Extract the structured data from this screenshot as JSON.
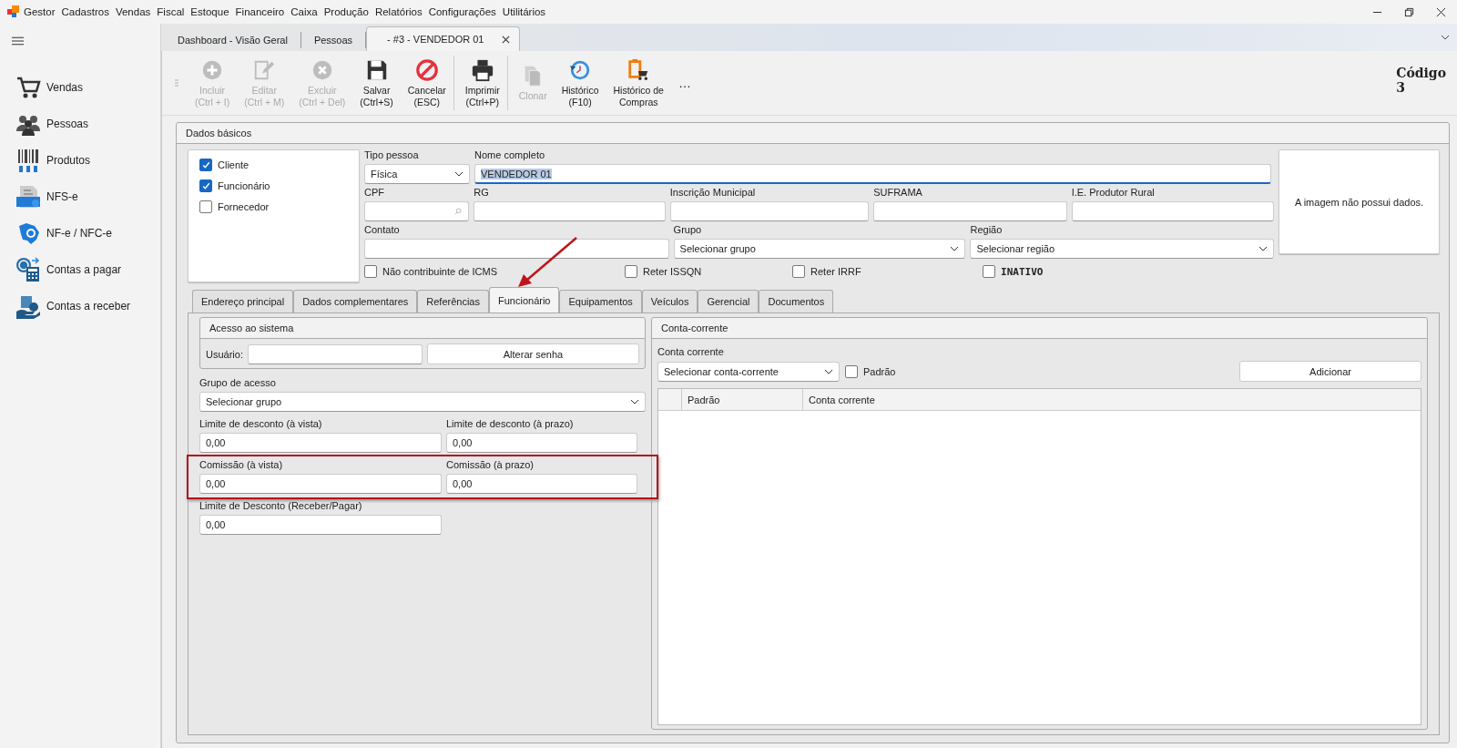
{
  "menu": {
    "app": "Gestor",
    "items": [
      "Cadastros",
      "Vendas",
      "Fiscal",
      "Estoque",
      "Financeiro",
      "Caixa",
      "Produção",
      "Relatórios",
      "Configurações",
      "Utilitários"
    ]
  },
  "sidebar": {
    "items": [
      {
        "label": "Vendas",
        "kind": "cart"
      },
      {
        "label": "Pessoas",
        "kind": "people"
      },
      {
        "label": "Produtos",
        "kind": "barcode"
      },
      {
        "label": "NFS-e",
        "kind": "nfse"
      },
      {
        "label": "NF-e / NFC-e",
        "kind": "nfe"
      },
      {
        "label": "Contas a pagar",
        "kind": "pay"
      },
      {
        "label": "Contas a receber",
        "kind": "receive"
      }
    ]
  },
  "doc_tabs": [
    {
      "label": "Dashboard - Visão Geral",
      "selected": false,
      "closable": false
    },
    {
      "label": "Pessoas",
      "selected": false,
      "closable": false
    },
    {
      "label": "- #3 - VENDEDOR 01",
      "selected": true,
      "closable": true
    }
  ],
  "toolbar": {
    "buttons": [
      {
        "label": "Incluir",
        "shortcut": "(Ctrl + I)",
        "kind": "add",
        "disabled": true,
        "separator_after": false
      },
      {
        "label": "Editar",
        "shortcut": "(Ctrl + M)",
        "kind": "edit",
        "disabled": true,
        "separator_after": false
      },
      {
        "label": "Excluir",
        "shortcut": "(Ctrl + Del)",
        "kind": "delete",
        "disabled": true,
        "separator_after": false
      },
      {
        "label": "Salvar",
        "shortcut": "(Ctrl+S)",
        "kind": "save",
        "disabled": false,
        "separator_after": false
      },
      {
        "label": "Cancelar",
        "shortcut": "(ESC)",
        "kind": "cancel",
        "disabled": false,
        "separator_after": true
      },
      {
        "label": "Imprimir",
        "shortcut": "(Ctrl+P)",
        "kind": "print",
        "disabled": false,
        "separator_after": true
      },
      {
        "label": "Clonar",
        "kind": "clone",
        "disabled": true,
        "separator_after": false
      },
      {
        "label": "Histórico",
        "shortcut": "(F10)",
        "kind": "history",
        "disabled": false,
        "separator_after": false
      },
      {
        "label": "Histórico de",
        "shortcut": "Compras",
        "kind": "purchases",
        "disabled": false,
        "separator_after": false
      }
    ],
    "overflow": "…"
  },
  "code": {
    "label": "Código",
    "value": "3"
  },
  "basic": {
    "title": "Dados básicos",
    "roles": [
      {
        "label": "Cliente",
        "checked": true
      },
      {
        "label": "Funcionário",
        "checked": true
      },
      {
        "label": "Fornecedor",
        "checked": false
      }
    ],
    "fields": {
      "person_type": {
        "label": "Tipo pessoa",
        "kind": "select",
        "value": "Física"
      },
      "full_name": {
        "label": "Nome completo",
        "kind": "text",
        "value": "VENDEDOR 01",
        "focused": true
      },
      "cpf": {
        "label": "CPF",
        "kind": "search"
      },
      "rg": {
        "label": "RG",
        "kind": "text"
      },
      "municipal_registration": {
        "label": "Inscrição Municipal",
        "kind": "text"
      },
      "suframa": {
        "label": "SUFRAMA",
        "kind": "text"
      },
      "rural_registration": {
        "label": "I.E. Produtor Rural",
        "kind": "text"
      },
      "contact": {
        "label": "Contato",
        "kind": "text"
      },
      "group": {
        "label": "Grupo",
        "kind": "select",
        "value": "Selecionar grupo"
      },
      "region": {
        "label": "Região",
        "kind": "select",
        "value": "Selecionar região"
      }
    },
    "checks": [
      {
        "label": "Não contribuinte de ICMS",
        "checked": false,
        "bold": false
      },
      {
        "label": "Reter ISSQN",
        "checked": false,
        "bold": false
      },
      {
        "label": "Reter IRRF",
        "checked": false,
        "bold": false
      },
      {
        "label": "INATIVO",
        "checked": false,
        "bold": true
      }
    ],
    "image_message": "A imagem não possui dados."
  },
  "section_tabs": [
    {
      "label": "Endereço principal",
      "selected": false,
      "marked": false
    },
    {
      "label": "Dados complementares",
      "selected": false,
      "marked": false
    },
    {
      "label": "Referências",
      "selected": false,
      "marked": false
    },
    {
      "label": "Funcionário",
      "selected": true,
      "marked": true
    },
    {
      "label": "Equipamentos",
      "selected": false,
      "marked": false
    },
    {
      "label": "Veículos",
      "selected": false,
      "marked": false
    },
    {
      "label": "Gerencial",
      "selected": false,
      "marked": false
    },
    {
      "label": "Documentos",
      "selected": false,
      "marked": false
    }
  ],
  "access": {
    "title": "Acesso ao sistema",
    "user_label": "Usuário:",
    "button": "Alterar senha",
    "group_label": "Grupo de acesso",
    "group_value": "Selecionar grupo",
    "rows": [
      {
        "highlighted": false,
        "fields": [
          {
            "label": "Limite de desconto (à vista)",
            "value": "0,00"
          },
          {
            "label": "Limite de desconto (à prazo)",
            "value": "0,00"
          }
        ]
      },
      {
        "highlighted": true,
        "fields": [
          {
            "label": "Comissão (à vista)",
            "value": "0,00"
          },
          {
            "label": "Comissão (à prazo)",
            "value": "0,00"
          }
        ]
      },
      {
        "highlighted": false,
        "fields": [
          {
            "label": "Limite de Desconto (Receber/Pagar)",
            "value": "0,00"
          }
        ]
      }
    ]
  },
  "account": {
    "title": "Conta-corrente",
    "field_label": "Conta corrente",
    "select_value": "Selecionar conta-corrente",
    "default_check": {
      "label": "Padrão",
      "checked": false
    },
    "button": "Adicionar",
    "table": {
      "columns": [
        "Padrão",
        "Conta corrente"
      ]
    }
  }
}
